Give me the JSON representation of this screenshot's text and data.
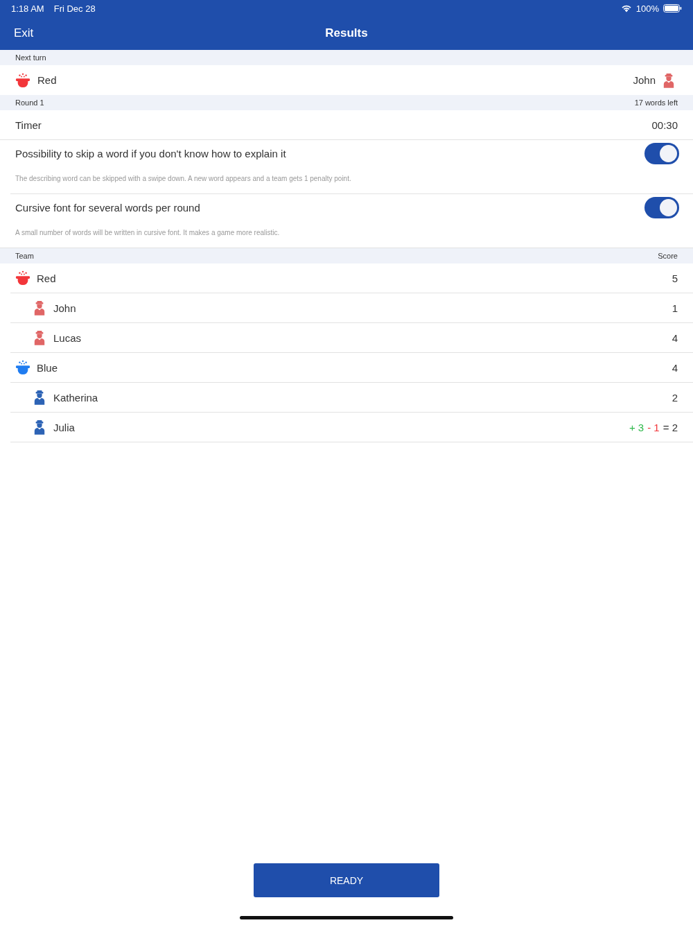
{
  "status_bar": {
    "time": "1:18 AM",
    "date": "Fri Dec 28",
    "battery": "100%"
  },
  "nav": {
    "back": "Exit",
    "title": "Results"
  },
  "next_turn": {
    "header": "Next turn",
    "team": {
      "name": "Red",
      "color": "#f2363a"
    },
    "player": {
      "name": "John",
      "color": "#e06666"
    }
  },
  "round": {
    "header": "Round 1",
    "words_left": "17 words left"
  },
  "timer": {
    "label": "Timer",
    "value": "00:30"
  },
  "settings": [
    {
      "label": "Possibility to skip a word if you don't know how to explain it",
      "on": true,
      "description": "The describing word can be skipped with a swipe down. A new word appears and a team gets 1 penalty point."
    },
    {
      "label": "Cursive font for several words per round",
      "on": true,
      "description": "A small number of words will be written in cursive font. It makes a game more realistic."
    }
  ],
  "scores": {
    "columns": [
      "Team",
      "Score"
    ],
    "teams": [
      {
        "name": "Red",
        "color": "#f2363a",
        "score": [
          {
            "kind": "total",
            "text": "5"
          }
        ],
        "children": [
          {
            "name": "John",
            "color": "#e06666",
            "score": [
              {
                "kind": "total",
                "text": "1"
              }
            ]
          },
          {
            "name": "Lucas",
            "color": "#e06666",
            "score": [
              {
                "kind": "total",
                "text": "4"
              }
            ]
          }
        ]
      },
      {
        "name": "Blue",
        "color": "#1f7cf0",
        "score": [
          {
            "kind": "total",
            "text": "4"
          }
        ],
        "children": [
          {
            "name": "Katherina",
            "color": "#2d63b5",
            "score": [
              {
                "kind": "total",
                "text": "2"
              }
            ]
          },
          {
            "name": "Julia",
            "color": "#2d63b5",
            "score": [
              {
                "kind": "plus",
                "text": "+ 3"
              },
              {
                "kind": "minus",
                "text": "- 1"
              },
              {
                "kind": "total",
                "text": "= 2"
              }
            ]
          }
        ]
      }
    ]
  },
  "ready_button": "READY"
}
